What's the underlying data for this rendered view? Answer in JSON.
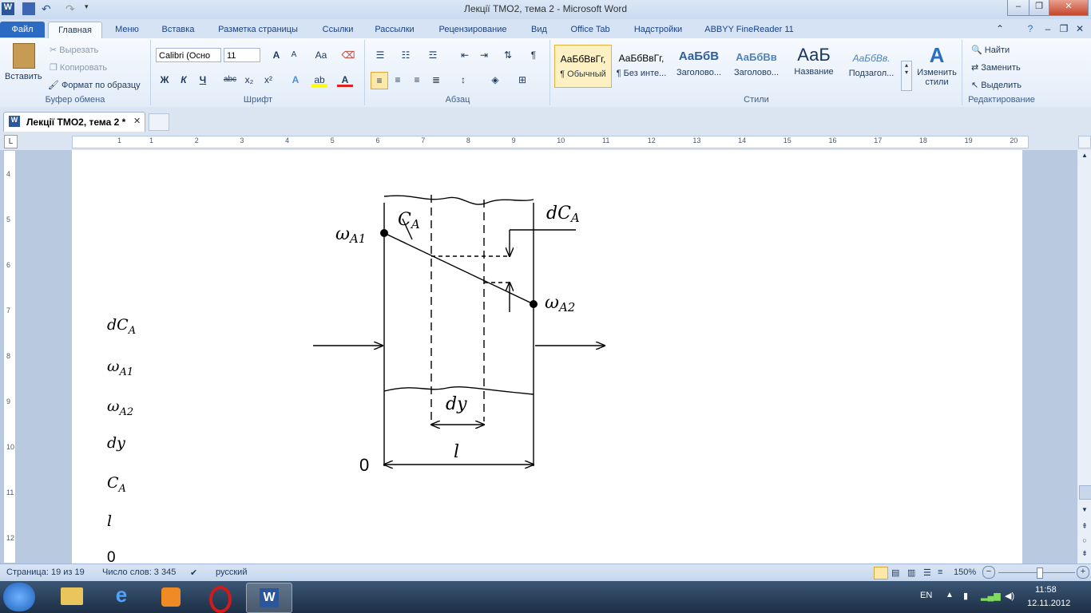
{
  "window": {
    "title": "Лекції ТМО2, тема 2  -  Microsoft Word"
  },
  "ribbon_tabs": [
    "Файл",
    "Главная",
    "Меню",
    "Вставка",
    "Разметка страницы",
    "Ссылки",
    "Рассылки",
    "Рецензирование",
    "Вид",
    "Office Tab",
    "Надстройки",
    "ABBYY FineReader 11"
  ],
  "clipboard": {
    "paste": "Вставить",
    "cut": "Вырезать",
    "copy": "Копировать",
    "format_painter": "Формат по образцу",
    "label": "Буфер обмена"
  },
  "font": {
    "name": "Calibri (Осно",
    "size": "11",
    "label": "Шрифт",
    "bold": "Ж",
    "italic": "К",
    "underline": "Ч",
    "strike": "abc",
    "sub": "x₂",
    "sup": "x²",
    "grow": "A",
    "shrink": "A",
    "case": "Aa"
  },
  "paragraph": {
    "label": "Абзац"
  },
  "styles": {
    "label": "Стили",
    "items": [
      {
        "preview": "АаБбВвГг,",
        "name": "¶ Обычный"
      },
      {
        "preview": "АаБбВвГг,",
        "name": "¶ Без инте..."
      },
      {
        "preview": "АаБбВ",
        "name": "Заголово..."
      },
      {
        "preview": "АаБбВв",
        "name": "Заголово..."
      },
      {
        "preview": "АаБ",
        "name": "Название"
      },
      {
        "preview": "АаБбВв.",
        "name": "Подзагол..."
      }
    ],
    "change": "Изменить стили"
  },
  "editing": {
    "label": "Редактирование",
    "find": "Найти",
    "replace": "Заменить",
    "select": "Выделить"
  },
  "doc_tab": {
    "label": "Лекції ТМО2, тема 2 *"
  },
  "ruler": {
    "ticks": [
      "1",
      "1",
      "2",
      "3",
      "4",
      "5",
      "6",
      "7",
      "8",
      "9",
      "10",
      "11",
      "12",
      "13",
      "14",
      "15",
      "16",
      "17",
      "18",
      "19",
      "20"
    ],
    "vticks": [
      "4",
      "5",
      "6",
      "7",
      "8",
      "9",
      "10",
      "11",
      "12"
    ]
  },
  "diagram": {
    "omega_a1": "ω",
    "omega_a1_sub": "A1",
    "omega_a2": "ω",
    "omega_a2_sub": "A2",
    "ca": "C",
    "ca_sub": "A",
    "dca": "dC",
    "dca_sub": "A",
    "dy": "dy",
    "l": "l",
    "zero": "0"
  },
  "legend": [
    {
      "main": "dC",
      "sub": "A"
    },
    {
      "main": "ω",
      "sub": "A1"
    },
    {
      "main": "ω",
      "sub": "A2"
    },
    {
      "main": "dy",
      "sub": ""
    },
    {
      "main": "C",
      "sub": "A"
    },
    {
      "main": "l",
      "sub": ""
    },
    {
      "main": "0",
      "sub": ""
    }
  ],
  "status": {
    "page": "Страница: 19 из 19",
    "words": "Число слов: 3 345",
    "lang": "русский",
    "zoom": "150%"
  },
  "taskbar": {
    "lang": "EN",
    "time": "11:58",
    "date": "12.11.2012"
  }
}
